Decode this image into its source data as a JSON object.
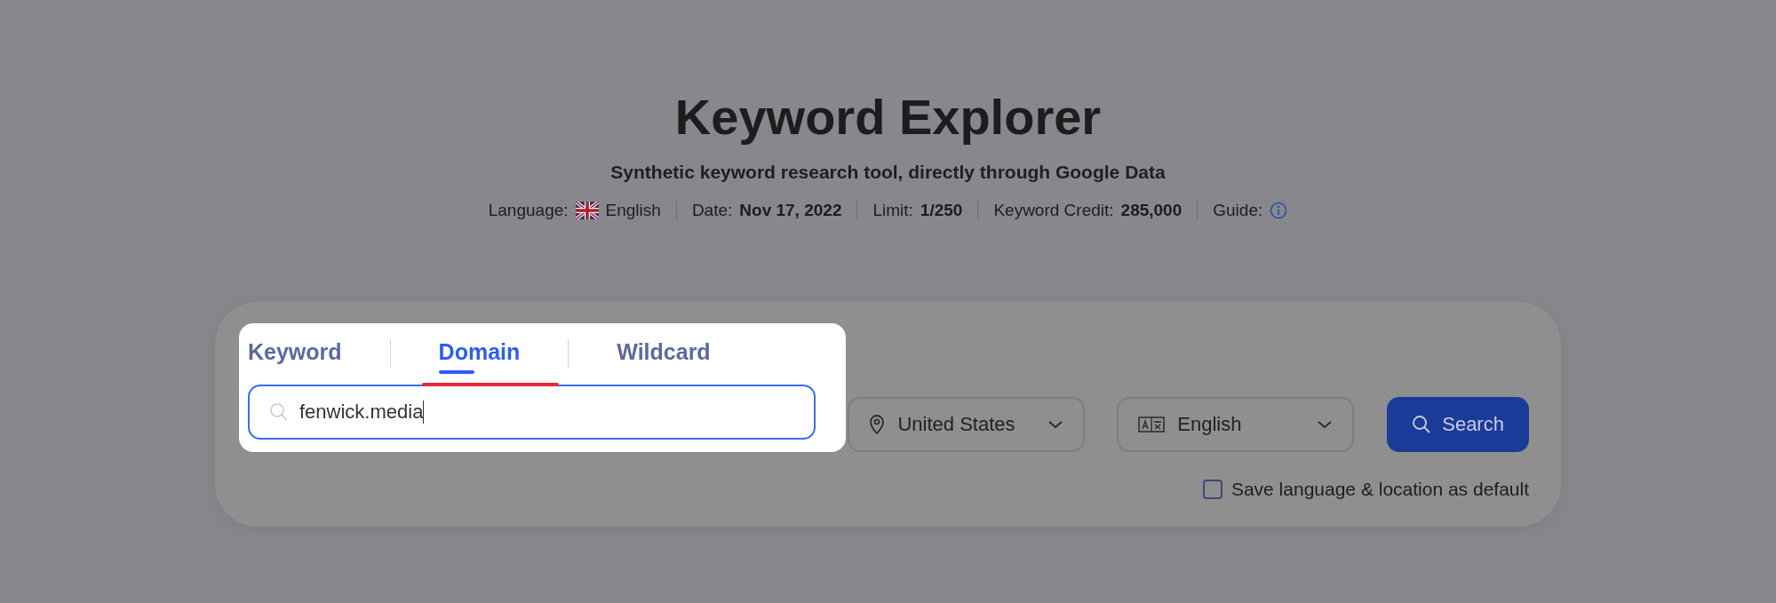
{
  "title": "Keyword Explorer",
  "subtitle": "Synthetic keyword research tool, directly through Google Data",
  "meta": [
    {
      "kind": "language",
      "label": "Language:",
      "value": "English"
    },
    {
      "kind": "value",
      "label": "Date:",
      "value": "Nov 17, 2022"
    },
    {
      "kind": "value",
      "label": "Limit:",
      "value": "1/250"
    },
    {
      "kind": "value",
      "label": "Keyword Credit:",
      "value": "285,000"
    },
    {
      "kind": "info",
      "label": "Guide:"
    }
  ],
  "tabs": [
    {
      "label": "Keyword",
      "selected": false
    },
    {
      "label": "Domain",
      "selected": true
    },
    {
      "label": "Wildcard",
      "selected": false
    }
  ],
  "search_field": {
    "value": "fenwick.media"
  },
  "location_select": {
    "value": "United States"
  },
  "language_select": {
    "value": "English"
  },
  "search_button": {
    "label": "Search"
  },
  "save_default": {
    "label": "Save language & location as default",
    "checked": false
  }
}
